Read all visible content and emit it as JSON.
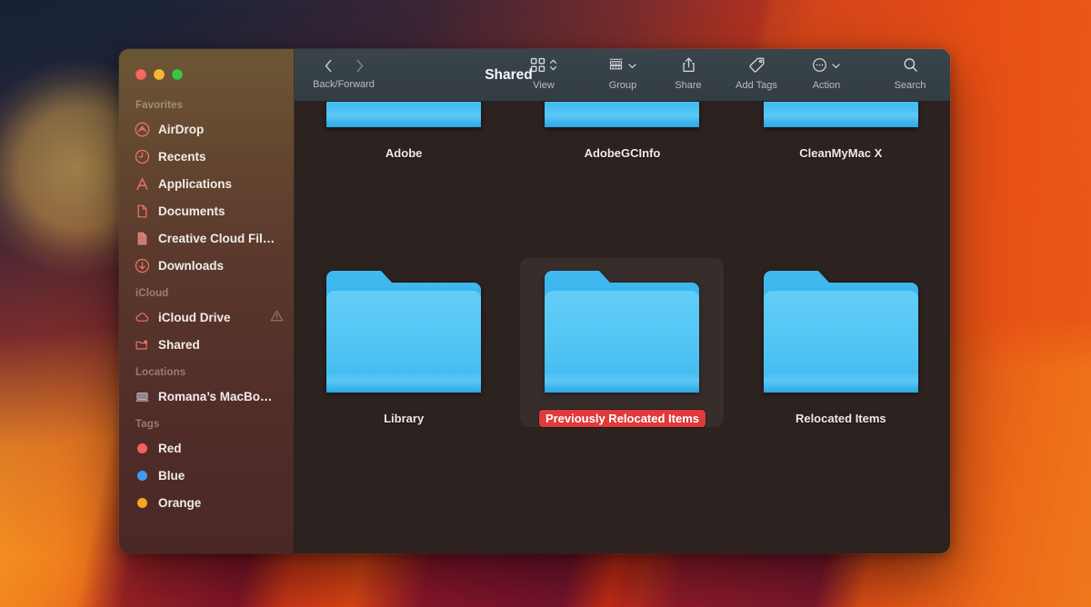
{
  "window": {
    "title": "Shared",
    "traffic_lights": [
      {
        "name": "close",
        "color": "#f9655f"
      },
      {
        "name": "minimize",
        "color": "#f8b637"
      },
      {
        "name": "zoom",
        "color": "#3bc544"
      }
    ]
  },
  "toolbar": {
    "nav_caption": "Back/Forward",
    "back_icon": "chevron-left-icon",
    "forward_icon": "chevron-right-icon",
    "buttons": [
      {
        "id": "view",
        "label": "View",
        "icon": "grid-view-icon",
        "chevron": "up-down-chevron-icon"
      },
      {
        "id": "group",
        "label": "Group",
        "icon": "group-rows-icon",
        "chevron": "chevron-down-icon"
      },
      {
        "id": "share",
        "label": "Share",
        "icon": "share-icon",
        "chevron": ""
      },
      {
        "id": "add-tags",
        "label": "Add Tags",
        "icon": "tag-icon",
        "chevron": ""
      },
      {
        "id": "action",
        "label": "Action",
        "icon": "ellipsis-circle-icon",
        "chevron": "chevron-down-icon"
      },
      {
        "id": "search",
        "label": "Search",
        "icon": "search-icon",
        "chevron": ""
      }
    ]
  },
  "sidebar": {
    "sections": [
      {
        "header": "Favorites",
        "items": [
          {
            "label": "AirDrop",
            "icon": "airdrop-icon",
            "color": "#f1756b",
            "warning": false
          },
          {
            "label": "Recents",
            "icon": "clock-icon",
            "color": "#f1756b",
            "warning": false
          },
          {
            "label": "Applications",
            "icon": "applications-icon",
            "color": "#f1756b",
            "warning": false
          },
          {
            "label": "Documents",
            "icon": "document-icon",
            "color": "#f1756b",
            "warning": false
          },
          {
            "label": "Creative Cloud Fil…",
            "icon": "document-filled-icon",
            "color": "#e08a7d",
            "warning": false
          },
          {
            "label": "Downloads",
            "icon": "download-icon",
            "color": "#f1756b",
            "warning": false
          }
        ]
      },
      {
        "header": "iCloud",
        "items": [
          {
            "label": "iCloud Drive",
            "icon": "cloud-icon",
            "color": "#f1756b",
            "warning": true
          },
          {
            "label": "Shared",
            "icon": "shared-folder-icon",
            "color": "#f1756b",
            "warning": false
          }
        ]
      },
      {
        "header": "Locations",
        "items": [
          {
            "label": "Romana’s MacBo…",
            "icon": "laptop-icon",
            "color": "#b8aeb0",
            "warning": false
          }
        ]
      },
      {
        "header": "Tags",
        "items": [
          {
            "label": "Red",
            "icon": "tag-dot-red",
            "color": "#f5635c",
            "warning": false
          },
          {
            "label": "Blue",
            "icon": "tag-dot-blue",
            "color": "#3d9bf5",
            "warning": false
          },
          {
            "label": "Orange",
            "icon": "tag-dot-orange",
            "color": "#f5a623",
            "warning": false
          }
        ]
      }
    ]
  },
  "content": {
    "folder_color": "#4cc2f1",
    "tag_highlight_color": "#e03a3a",
    "rows": [
      {
        "items": [
          {
            "name": "Adobe",
            "icon": "folder-icon",
            "selected": false,
            "tagged": false
          },
          {
            "name": "AdobeGCInfo",
            "icon": "folder-icon",
            "selected": false,
            "tagged": false
          },
          {
            "name": "CleanMyMac X",
            "icon": "folder-icon",
            "selected": false,
            "tagged": false
          }
        ]
      },
      {
        "items": [
          {
            "name": "Library",
            "icon": "folder-icon",
            "selected": false,
            "tagged": false
          },
          {
            "name": "Previously Relocated Items",
            "icon": "folder-icon",
            "selected": true,
            "tagged": true
          },
          {
            "name": "Relocated Items",
            "icon": "folder-icon",
            "selected": false,
            "tagged": false
          }
        ]
      }
    ]
  }
}
